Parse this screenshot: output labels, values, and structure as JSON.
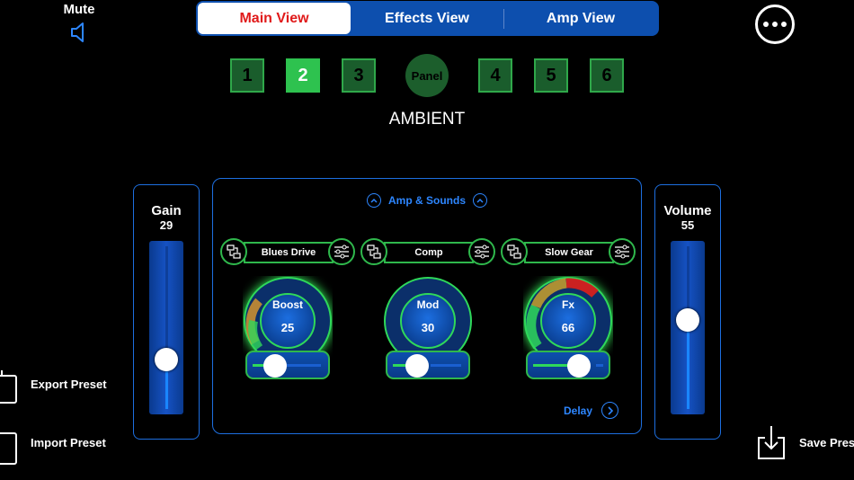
{
  "mute": {
    "label": "Mute"
  },
  "tabs": [
    {
      "label": "Main View",
      "active": true
    },
    {
      "label": "Effects View",
      "active": false
    },
    {
      "label": "Amp View",
      "active": false
    }
  ],
  "presets": {
    "buttons": [
      "1",
      "2",
      "3",
      "4",
      "5",
      "6"
    ],
    "selected": "2",
    "panel_label": "Panel",
    "name": "AMBIENT"
  },
  "gain": {
    "label": "Gain",
    "value": "29"
  },
  "volume": {
    "label": "Volume",
    "value": "55"
  },
  "center": {
    "header": "Amp & Sounds",
    "footer": "Delay",
    "slots": [
      {
        "name": "Blues Drive",
        "dial_label": "Boost",
        "value": "25"
      },
      {
        "name": "Comp",
        "dial_label": "Mod",
        "value": "30"
      },
      {
        "name": "Slow Gear",
        "dial_label": "Fx",
        "value": "66"
      }
    ]
  },
  "actions": {
    "export": "Export Preset",
    "import": "Import Preset",
    "save": "Save Pres"
  },
  "colors": {
    "accent_blue": "#1d6fe0",
    "accent_green": "#2fb84c",
    "active_red": "#e01a1a"
  }
}
